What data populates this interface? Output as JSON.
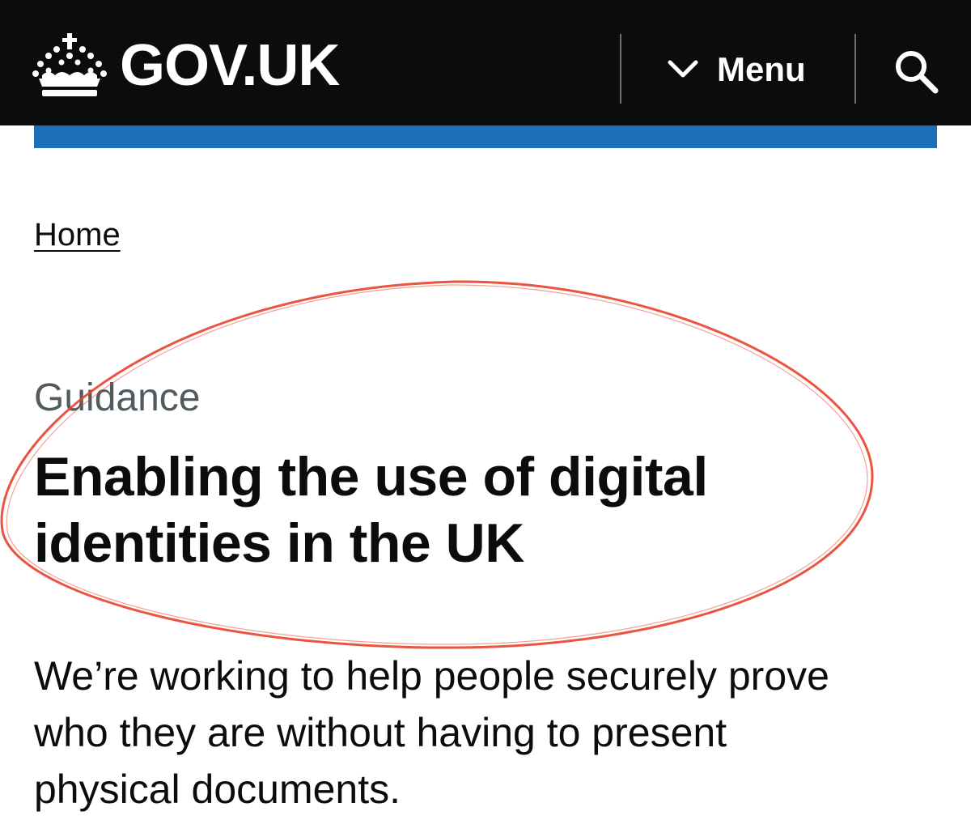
{
  "header": {
    "logo_text": "GOV.UK",
    "menu_label": "Menu",
    "colors": {
      "header_background": "#0b0c0c",
      "brand_bar": "#1d70b8",
      "text_primary": "#0b0c0c",
      "text_secondary": "#505a5f",
      "annotation_ellipse": "#e8432b"
    },
    "icons": [
      "crown-logo-icon",
      "chevron-down-icon",
      "search-icon"
    ]
  },
  "breadcrumb": {
    "home_label": "Home"
  },
  "main": {
    "caption": "Guidance",
    "title": "Enabling the use of digital identities in the UK",
    "lead": "We’re working to help people securely prove who they are without having to present physical documents."
  }
}
